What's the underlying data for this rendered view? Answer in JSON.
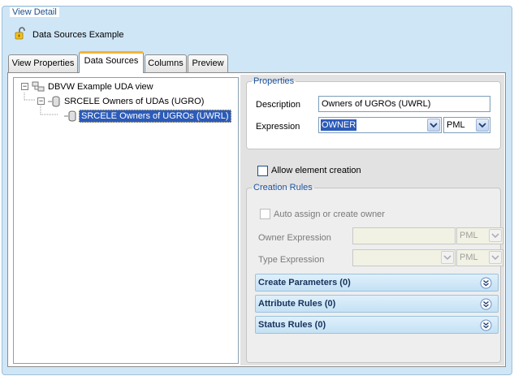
{
  "frame": {
    "title": "View Detail"
  },
  "header": {
    "title": "Data Sources Example",
    "icon": "padlock-open-icon"
  },
  "tabs": [
    {
      "label": "View Properties",
      "active": false
    },
    {
      "label": "Data Sources",
      "active": true
    },
    {
      "label": "Columns",
      "active": false
    },
    {
      "label": "Preview",
      "active": false
    }
  ],
  "tree": {
    "nodes": [
      {
        "label": "DBVW Example UDA view",
        "icon": "view-icon",
        "expander": "−"
      },
      {
        "label": "SRCELE Owners of UDAs (UGRO)",
        "icon": "database-icon",
        "expander": "−"
      },
      {
        "label": "SRCELE Owners of UGROs (UWRL)",
        "icon": "database-icon",
        "selected": true
      }
    ]
  },
  "properties": {
    "legend": "Properties",
    "description_label": "Description",
    "description_value": "Owners of UGROs (UWRL)",
    "expression_label": "Expression",
    "expression_value": "OWNER",
    "expression_lang": "PML"
  },
  "allow_creation_label": "Allow element creation",
  "creation_rules": {
    "legend": "Creation Rules",
    "auto_assign_label": "Auto assign or create owner",
    "owner_expression_label": "Owner Expression",
    "owner_lang": "PML",
    "type_expression_label": "Type Expression",
    "type_lang": "PML",
    "sections": [
      {
        "title": "Create Parameters (0)"
      },
      {
        "title": "Attribute Rules (0)"
      },
      {
        "title": "Status Rules (0)"
      }
    ]
  },
  "colors": {
    "accent": "#f0b537",
    "selection": "#2c5bb8",
    "legend": "#1d54a3"
  }
}
